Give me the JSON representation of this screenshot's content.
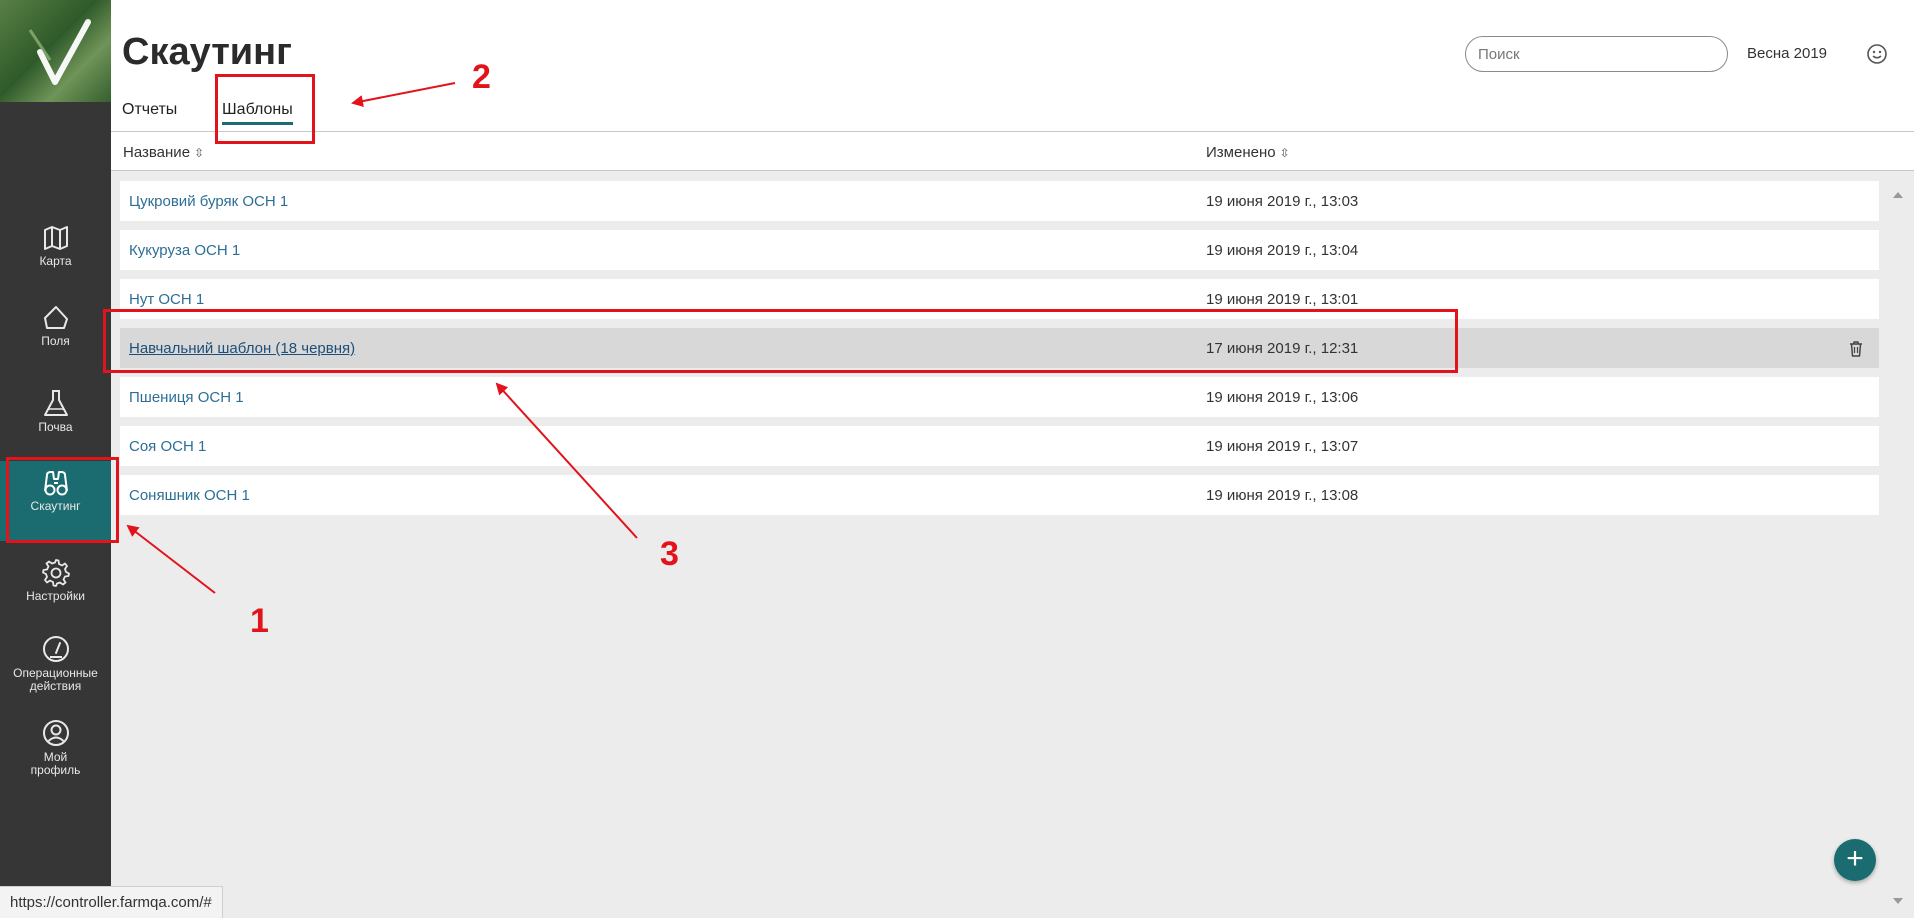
{
  "sidebar": {
    "items": [
      {
        "icon": "map-icon",
        "label": "Карта"
      },
      {
        "icon": "field-icon",
        "label": "Поля"
      },
      {
        "icon": "flask-icon",
        "label": "Почва"
      },
      {
        "icon": "binoculars-icon",
        "label": "Скаутинг",
        "active": true
      },
      {
        "icon": "gear-icon",
        "label": "Настройки"
      },
      {
        "icon": "gauge-icon",
        "label": "Операционные\nдействия"
      },
      {
        "icon": "profile-icon",
        "label": "Мой\nпрофиль"
      }
    ]
  },
  "header": {
    "title": "Скаутинг",
    "tabs": [
      {
        "label": "Отчеты"
      },
      {
        "label": "Шаблоны",
        "active": true
      }
    ],
    "search_placeholder": "Поиск",
    "season": "Весна 2019"
  },
  "table": {
    "columns": [
      {
        "label": "Название"
      },
      {
        "label": "Изменено"
      }
    ],
    "rows": [
      {
        "name": "Цукровий буряк ОСН 1",
        "modified": "19 июня 2019 г., 13:03"
      },
      {
        "name": "Кукуруза ОСН 1",
        "modified": "19 июня 2019 г., 13:04"
      },
      {
        "name": "Нут ОСН 1",
        "modified": "19 июня 2019 г., 13:01"
      },
      {
        "name": "Навчальний шаблон (18 червня)",
        "modified": "17 июня 2019 г., 12:31"
      },
      {
        "name": "Пшениця ОСН 1",
        "modified": "19 июня 2019 г., 13:06"
      },
      {
        "name": "Соя ОСН 1",
        "modified": "19 июня 2019 г., 13:07"
      },
      {
        "name": "Соняшник ОСН 1",
        "modified": "19 июня 2019 г., 13:08"
      }
    ]
  },
  "fab_label": "+",
  "status_url": "https://controller.farmqa.com/#",
  "annotations": {
    "n1": "1",
    "n2": "2",
    "n3": "3"
  },
  "colors": {
    "accent": "#1b6c70",
    "sidebar": "#363636",
    "annotation": "#e3131b",
    "link": "#2c6e96"
  }
}
